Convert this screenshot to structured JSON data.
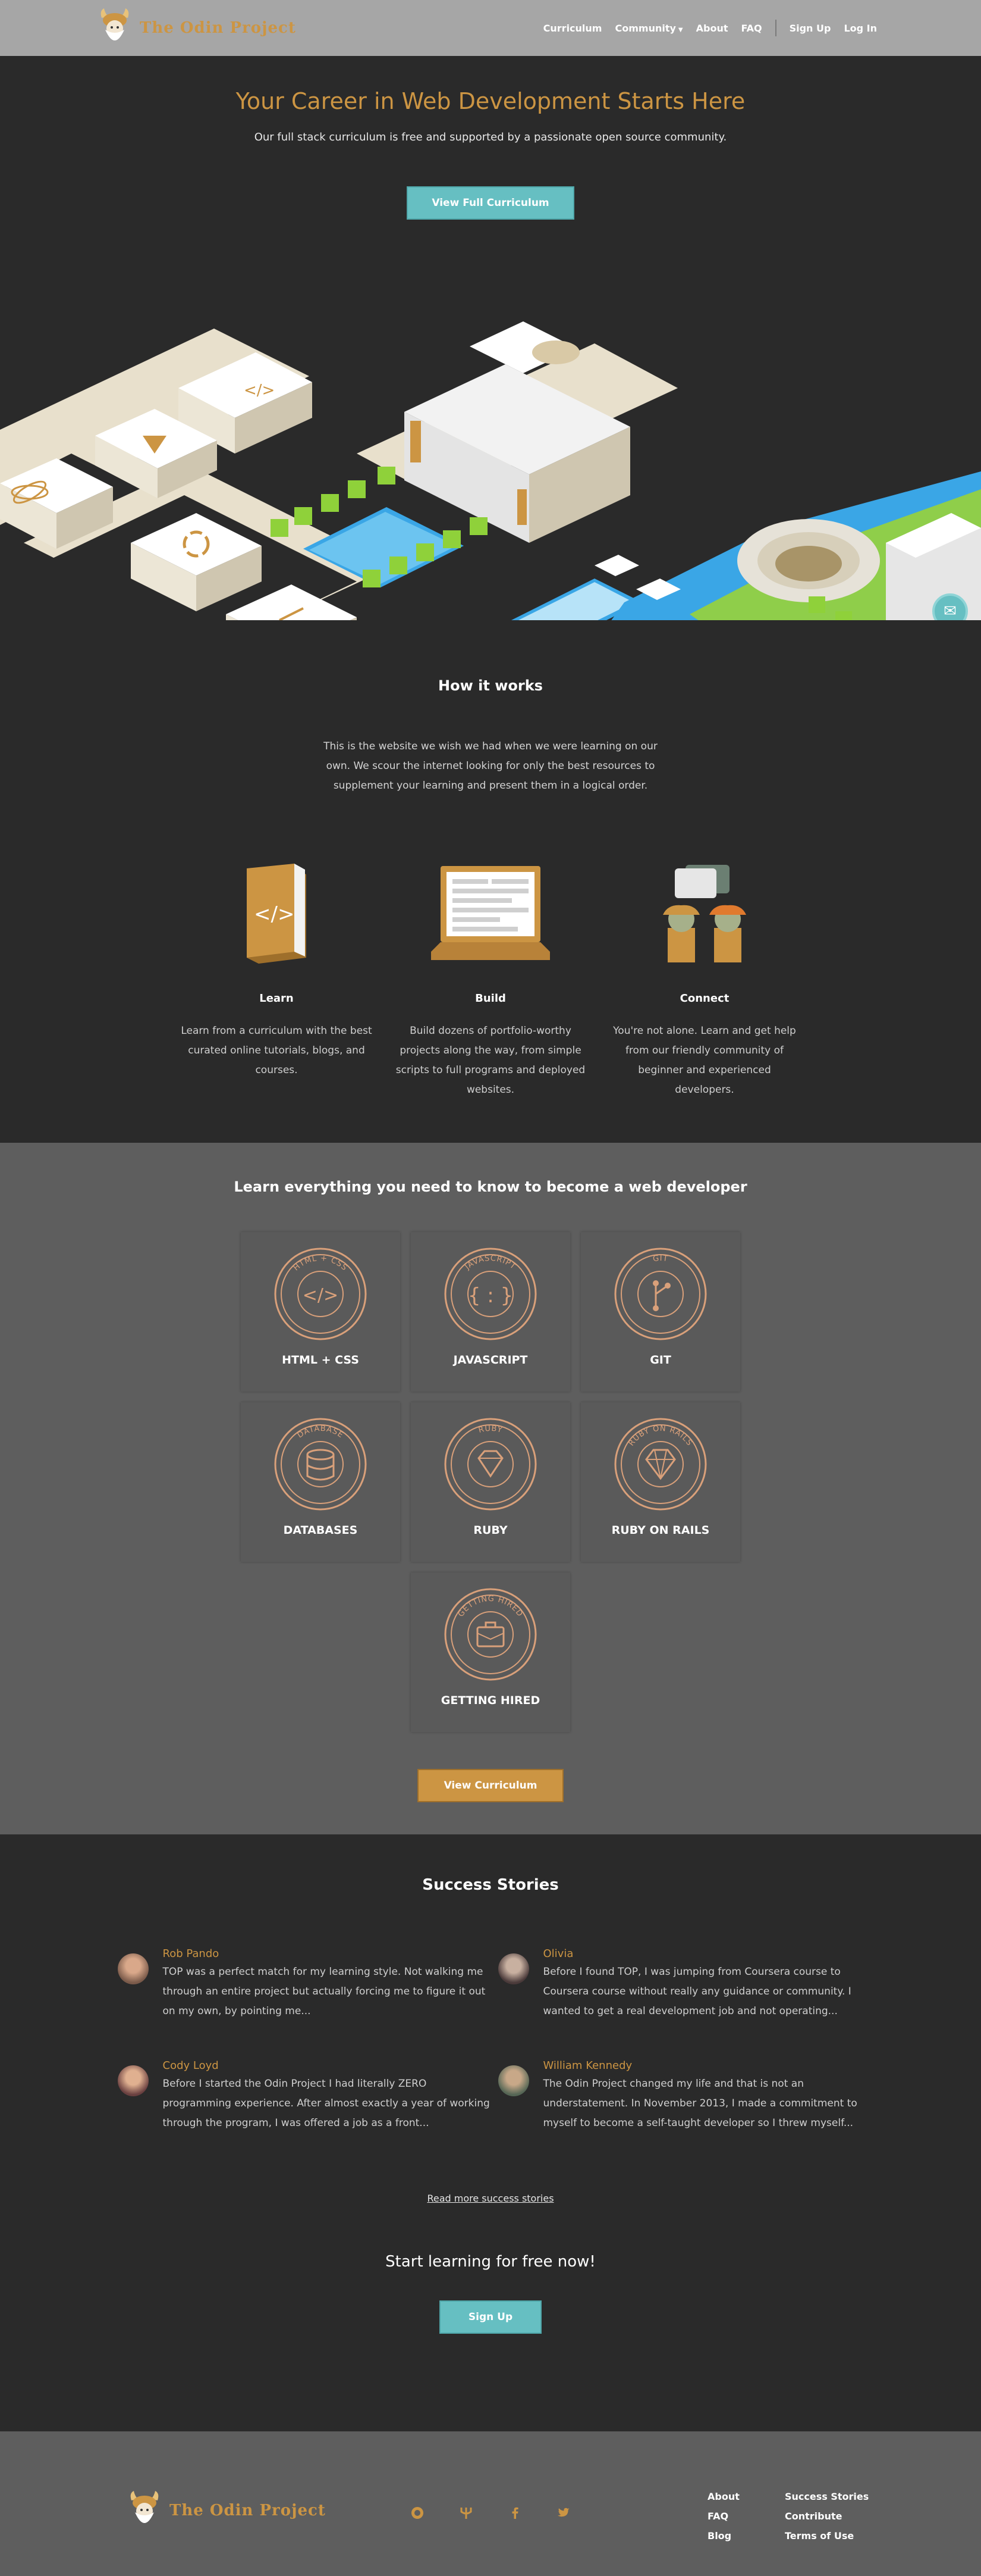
{
  "nav": {
    "brand": "The Odin Project",
    "links": [
      "Curriculum",
      "Community",
      "About",
      "FAQ"
    ],
    "auth": [
      "Sign Up",
      "Log In"
    ]
  },
  "hero": {
    "title": "Your Career in Web Development Starts Here",
    "subtitle": "Our full stack curriculum is free and supported by a passionate open source community.",
    "cta": "View Full Curriculum"
  },
  "how": {
    "title": "How it works",
    "intro": "This is the website we wish we had when we were learning on our own. We scour the internet looking for only the best resources to supplement your learning and present them in a logical order.",
    "features": [
      {
        "title": "Learn",
        "text": "Learn from a curriculum with the best curated online tutorials, blogs, and courses."
      },
      {
        "title": "Build",
        "text": "Build dozens of portfolio-worthy projects along the way, from simple scripts to full programs and deployed websites."
      },
      {
        "title": "Connect",
        "text": "You're not alone. Learn and get help from our friendly community of beginner and experienced developers."
      }
    ]
  },
  "paths": {
    "title": "Learn everything you need to know to become a web developer",
    "badges": [
      {
        "name": "HTML + CSS",
        "ring": "HTML + CSS",
        "icon": "code-brackets-icon"
      },
      {
        "name": "JAVASCRIPT",
        "ring": "JAVASCRIPT",
        "icon": "curly-braces-icon"
      },
      {
        "name": "GIT",
        "ring": "GIT",
        "icon": "git-branch-icon"
      },
      {
        "name": "DATABASES",
        "ring": "DATABASE",
        "icon": "database-icon"
      },
      {
        "name": "RUBY",
        "ring": "RUBY",
        "icon": "gem-icon"
      },
      {
        "name": "RUBY ON RAILS",
        "ring": "RUBY ON RAILS",
        "icon": "rails-gem-icon"
      },
      {
        "name": "GETTING HIRED",
        "ring": "GETTING HIRED",
        "icon": "briefcase-icon"
      }
    ],
    "cta": "View Curriculum"
  },
  "stories": {
    "title": "Success Stories",
    "items": [
      {
        "name": "Rob Pando",
        "text": "TOP was a perfect match for my learning style. Not walking me through an entire project but actually forcing me to figure it out on my own, by pointing me..."
      },
      {
        "name": "Olivia",
        "text": "Before I found TOP, I was jumping from Coursera course to Coursera course without really any guidance or community. I wanted to get a real development job and not operating..."
      },
      {
        "name": "Cody Loyd",
        "text": "Before I started the Odin Project I had literally ZERO programming experience. After almost exactly a year of working through the program, I was offered a job as a front..."
      },
      {
        "name": "William Kennedy",
        "text": "The Odin Project changed my life and that is not an understatement. In November 2013, I made a commitment to myself to become a self-taught developer so I threw myself..."
      }
    ],
    "read_more": "Read more success stories",
    "start_title": "Start learning for free now!",
    "signup": "Sign Up"
  },
  "footer": {
    "brand": "The Odin Project",
    "social": [
      "github-icon",
      "trident-icon",
      "facebook-icon",
      "twitter-icon"
    ],
    "links": [
      "About",
      "Success Stories",
      "FAQ",
      "Contribute",
      "Blog",
      "Terms of Use"
    ]
  },
  "colors": {
    "gold": "#cc9543",
    "teal": "#66bfc2",
    "dark": "#2a2a2a",
    "gray": "#5e5e5e"
  }
}
